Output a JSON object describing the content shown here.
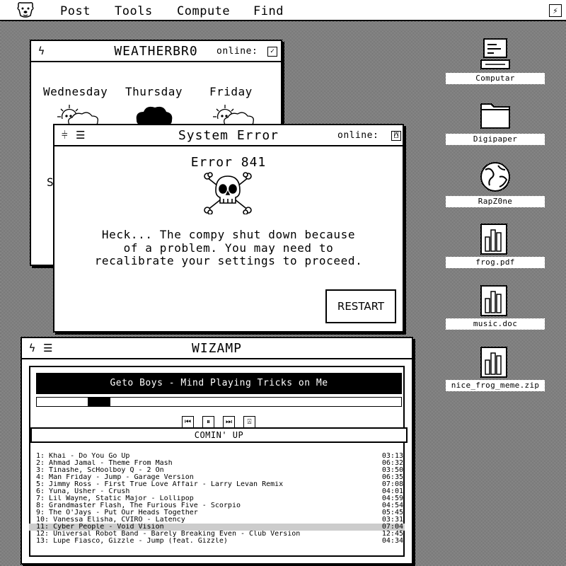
{
  "menubar": {
    "items": [
      "Post",
      "Tools",
      "Compute",
      "Find"
    ]
  },
  "weather": {
    "title": "WEATHERBR0",
    "online_label": "online:",
    "online_checked": true,
    "days": [
      {
        "name": "Wednesday",
        "icon": "partly-cloudy-icon"
      },
      {
        "name": "Thursday",
        "icon": "storm-cloud-icon"
      },
      {
        "name": "Friday",
        "icon": "partly-cloudy-icon"
      }
    ],
    "stub": "S"
  },
  "error": {
    "title": "System Error",
    "online_label": "online:",
    "code": "Error 841",
    "message_lines": [
      "Heck... The compy shut down because",
      "of a problem. You may need to",
      "recalibrate your settings to proceed."
    ],
    "restart_label": "RESTART"
  },
  "player": {
    "title": "WIZAMP",
    "now_playing": "Geto Boys - Mind Playing Tricks on Me",
    "progress": 0.14,
    "comin_up": "COMIN' UP",
    "tracks": [
      {
        "label": "1: Khai - Do You Go Up",
        "dur": "03:13"
      },
      {
        "label": "2: Ahmad Jamal - Theme From Mash",
        "dur": "06:32"
      },
      {
        "label": "3: Tinashe, ScHoolboy Q - 2 On",
        "dur": "03:50"
      },
      {
        "label": "4: Man Friday - Jump - Garage Version",
        "dur": "06:35"
      },
      {
        "label": "5: Jimmy Ross - First True Love Affair - Larry Levan Remix",
        "dur": "07:08"
      },
      {
        "label": "6: Yuna, Usher - Crush",
        "dur": "04:01"
      },
      {
        "label": "7: Lil Wayne, Static Major - Lollipop",
        "dur": "04:59"
      },
      {
        "label": "8: Grandmaster Flash, The Furious Five - Scorpio",
        "dur": "04:54"
      },
      {
        "label": "9: The O'Jays - Put Our Heads Together",
        "dur": "05:45"
      },
      {
        "label": "10: Vanessa Elisha, CVIRO - Latency",
        "dur": "03:31"
      },
      {
        "label": "11: Cyber People - Void Vision",
        "dur": "07:04"
      },
      {
        "label": "12: Universal Robot Band - Barely Breaking Even - Club Version",
        "dur": "12:45"
      },
      {
        "label": "13: Lupe Fiasco, Gizzle - Jump (feat. Gizzle)",
        "dur": "04:34"
      }
    ],
    "selected_index": 10
  },
  "desktop": [
    {
      "label": "Computar",
      "icon": "computer-icon"
    },
    {
      "label": "Digipaper",
      "icon": "folder-icon"
    },
    {
      "label": "RapZ0ne",
      "icon": "globe-icon"
    },
    {
      "label": "frog.pdf",
      "icon": "document-icon"
    },
    {
      "label": "music.doc",
      "icon": "document-icon"
    },
    {
      "label": "nice_frog_meme.zip",
      "icon": "document-icon"
    }
  ]
}
